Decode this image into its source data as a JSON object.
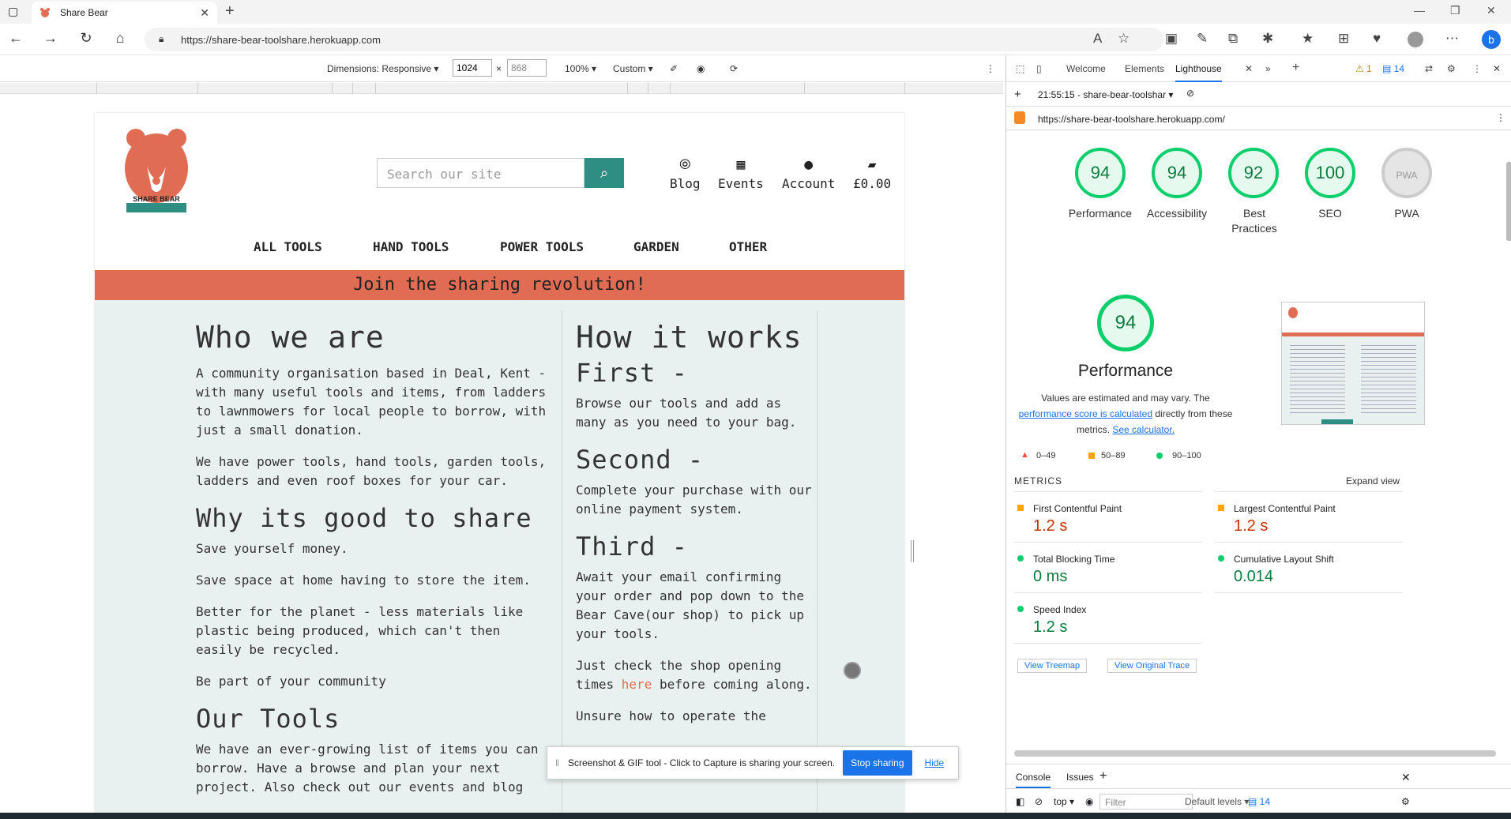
{
  "browser": {
    "tab_title": "Share Bear",
    "url": "https://share-bear-toolshare.herokuapp.com"
  },
  "device_toolbar": {
    "dimensions_label": "Dimensions: Responsive",
    "width": "1024",
    "height": "868",
    "zoom": "100%",
    "throttle": "Custom"
  },
  "site": {
    "logo_text": "SHARE BEAR",
    "search_placeholder": "Search our site",
    "nav": {
      "blog": "Blog",
      "events": "Events",
      "account": "Account",
      "bag": "£0.00"
    },
    "menu": [
      "ALL TOOLS",
      "HAND TOOLS",
      "POWER TOOLS",
      "GARDEN",
      "OTHER"
    ],
    "banner": "Join the sharing revolution!",
    "left": {
      "h_who": "Who we are",
      "p_who1": "A community organisation based in Deal, Kent - with many useful tools and items, from ladders to lawnmowers for local people to borrow, with just a small donation.",
      "p_who2": "We have power tools, hand tools, garden tools, ladders and even roof boxes for your car.",
      "h_why": "Why its good to share",
      "p_why1": "Save yourself money.",
      "p_why2": "Save space at home having to store the item.",
      "p_why3": "Better for the planet - less materials like plastic being produced, which can't then easily be recycled.",
      "p_why4": "Be part of your community",
      "h_tools": "Our Tools",
      "p_tools": "We have an ever-growing list of items you can borrow. Have a browse and plan your next project. Also check out our events and blog"
    },
    "right": {
      "h_how": "How it works",
      "h_first": "First -",
      "p_first": "Browse our tools and add as many as you need to your bag.",
      "h_second": "Second -",
      "p_second": "Complete your purchase with our online payment system.",
      "h_third": "Third -",
      "p_third": "Await your email confirming your order and pop down to the Bear Cave(our shop) to pick up your tools.",
      "p_check_pre": "Just check the shop opening times ",
      "p_check_link": "here",
      "p_check_post": " before coming along.",
      "p_unsure": "Unsure how to operate the"
    }
  },
  "share_bar": {
    "text": "Screenshot & GIF tool - Click to Capture is sharing your screen.",
    "stop": "Stop sharing",
    "hide": "Hide"
  },
  "devtools": {
    "tabs": [
      "Welcome",
      "Elements",
      "Lighthouse"
    ],
    "warn_count": "1",
    "msg_count": "14",
    "report_label": "21:55:15 - share-bear-toolshar",
    "report_url": "https://share-bear-toolshare.herokuapp.com/",
    "scores": [
      {
        "label": "Performance",
        "value": "94"
      },
      {
        "label": "Accessibility",
        "value": "94"
      },
      {
        "label": "Best Practices",
        "value": "92"
      },
      {
        "label": "SEO",
        "value": "100"
      },
      {
        "label": "PWA",
        "value": ""
      }
    ],
    "perf_score": "94",
    "perf_title": "Performance",
    "perf_desc_1": "Values are estimated and may vary. The",
    "perf_link": "performance score is calculated",
    "perf_desc_2": "directly from these metrics.",
    "perf_calc": "See calculator.",
    "legend": [
      "0–49",
      "50–89",
      "90–100"
    ],
    "metrics_title": "METRICS",
    "expand": "Expand view",
    "metrics": [
      {
        "label": "First Contentful Paint",
        "value": "1.2 s",
        "status": "orange"
      },
      {
        "label": "Largest Contentful Paint",
        "value": "1.2 s",
        "status": "orange"
      },
      {
        "label": "Total Blocking Time",
        "value": "0 ms",
        "status": "green"
      },
      {
        "label": "Cumulative Layout Shift",
        "value": "0.014",
        "status": "green"
      },
      {
        "label": "Speed Index",
        "value": "1.2 s",
        "status": "green"
      }
    ],
    "treemap": "View Treemap",
    "trace": "View Original Trace",
    "console_tabs": [
      "Console",
      "Issues"
    ],
    "context": "top",
    "filter_placeholder": "Filter",
    "levels": "Default levels",
    "console_count": "14"
  },
  "colors": {
    "accent": "#e06d53",
    "teal": "#2e8e84",
    "good": "#0cce6b",
    "average": "#ffa400",
    "bad": "#ff4e42"
  }
}
